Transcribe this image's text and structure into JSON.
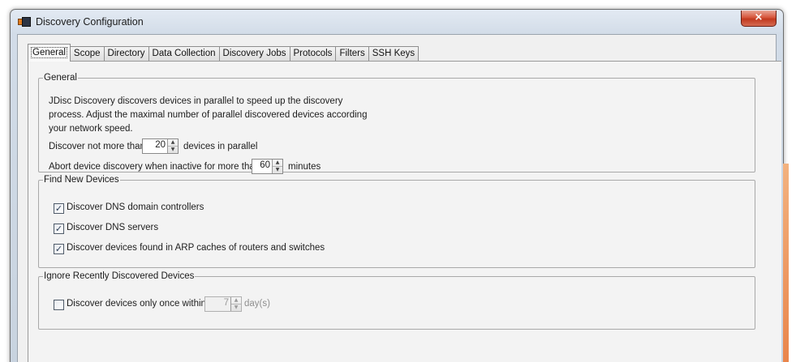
{
  "window": {
    "title": "Discovery Configuration",
    "close_label": "×"
  },
  "tabs": [
    {
      "label": "General"
    },
    {
      "label": "Scope"
    },
    {
      "label": "Directory"
    },
    {
      "label": "Data Collection"
    },
    {
      "label": "Discovery Jobs"
    },
    {
      "label": "Protocols"
    },
    {
      "label": "Filters"
    },
    {
      "label": "SSH Keys"
    }
  ],
  "general": {
    "legend": "General",
    "description_lines": [
      "JDisc Discovery discovers devices in parallel to speed up the discovery",
      "process. Adjust the maximal number of parallel discovered devices according",
      "your network speed."
    ],
    "parallel_prefix": "Discover not more than",
    "parallel_value": "20",
    "parallel_suffix": "devices in parallel",
    "abort_prefix": "Abort device discovery when inactive for more than",
    "abort_value": "60",
    "abort_suffix": "minutes"
  },
  "find_new_devices": {
    "legend": "Find New Devices",
    "options": [
      {
        "label": "Discover DNS domain controllers",
        "checked": true
      },
      {
        "label": "Discover DNS servers",
        "checked": true
      },
      {
        "label": "Discover devices found in ARP caches of routers and switches",
        "checked": true
      }
    ]
  },
  "ignore_recent": {
    "legend": "Ignore Recently Discovered Devices",
    "option_label": "Discover devices only once within",
    "checked": false,
    "days_value": "7",
    "days_unit": "day(s)"
  },
  "colors": {
    "accent_orange": "#e9844a",
    "close_red": "#c1391f"
  }
}
